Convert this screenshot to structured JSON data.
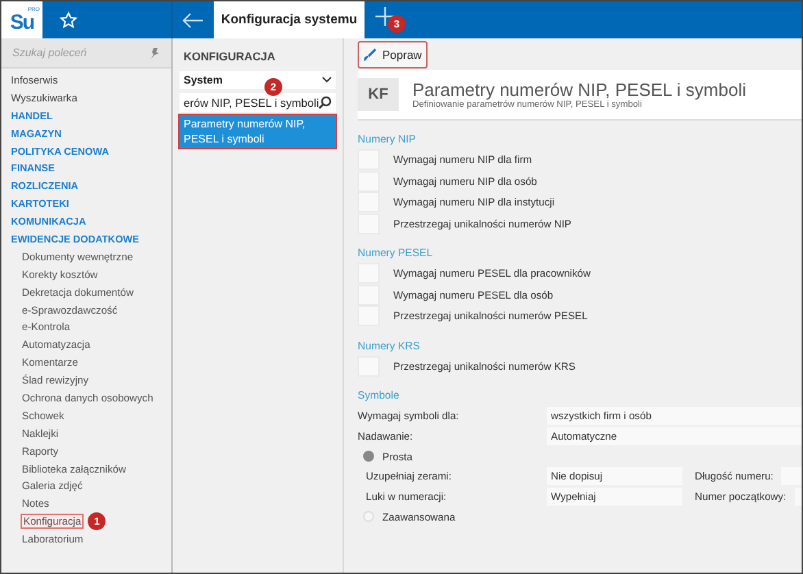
{
  "logo": {
    "text": "Su",
    "sup": "PRO"
  },
  "tab": {
    "title": "Konfiguracja systemu",
    "selected": true
  },
  "new_tab": {
    "badge": "3"
  },
  "sidebar": {
    "search_placeholder": "Szukaj poleceń",
    "items": [
      {
        "label": "Infoserwis",
        "kind": "plain"
      },
      {
        "label": "Wyszukiwarka",
        "kind": "plain"
      },
      {
        "label": "HANDEL",
        "kind": "section"
      },
      {
        "label": "MAGAZYN",
        "kind": "section"
      },
      {
        "label": "POLITYKA CENOWA",
        "kind": "section"
      },
      {
        "label": "FINANSE",
        "kind": "section"
      },
      {
        "label": "ROZLICZENIA",
        "kind": "section"
      },
      {
        "label": "KARTOTEKI",
        "kind": "section"
      },
      {
        "label": "KOMUNIKACJA",
        "kind": "section"
      },
      {
        "label": "EWIDENCJE DODATKOWE",
        "kind": "section"
      },
      {
        "label": "Dokumenty wewnętrzne",
        "kind": "item"
      },
      {
        "label": "Korekty kosztów",
        "kind": "item"
      },
      {
        "label": "Dekretacja dokumentów",
        "kind": "item"
      },
      {
        "label": "e-Sprawozdawczość",
        "kind": "item"
      },
      {
        "label": "e-Kontrola",
        "kind": "item"
      },
      {
        "label": "Automatyzacja",
        "kind": "item"
      },
      {
        "label": "Komentarze",
        "kind": "item"
      },
      {
        "label": "Ślad rewizyjny",
        "kind": "item"
      },
      {
        "label": "Ochrona danych osobowych",
        "kind": "item"
      },
      {
        "label": "Schowek",
        "kind": "item"
      },
      {
        "label": "Naklejki",
        "kind": "item"
      },
      {
        "label": "Raporty",
        "kind": "item"
      },
      {
        "label": "Biblioteka załączników",
        "kind": "item"
      },
      {
        "label": "Galeria zdjęć",
        "kind": "item"
      },
      {
        "label": "Notes",
        "kind": "item"
      },
      {
        "label": "Konfiguracja",
        "kind": "item",
        "highlighted": true,
        "badge": "1"
      },
      {
        "label": "Laboratorium",
        "kind": "item"
      }
    ]
  },
  "config_panel": {
    "title": "KONFIGURACJA",
    "select": "System",
    "search": {
      "value": "erów NIP, PESEL i symboli",
      "badge": "2"
    },
    "results": [
      {
        "label": "Parametry numerów NIP, PESEL i symboli",
        "selected": true,
        "highlighted": true
      }
    ]
  },
  "toolbar": {
    "buttons": [
      {
        "label": "Popraw",
        "highlighted": true
      }
    ]
  },
  "header": {
    "initials": "KF",
    "title": "Parametry numerów NIP, PESEL i symboli",
    "subtitle": "Definiowanie parametrów numerów NIP, PESEL i symboli"
  },
  "sections": [
    {
      "title": "Numery NIP",
      "checkboxes": [
        {
          "label": "Wymagaj numeru NIP dla firm",
          "checked": false
        },
        {
          "label": "Wymagaj numeru NIP dla osób",
          "checked": false
        },
        {
          "label": "Wymagaj numeru NIP dla instytucji",
          "checked": false
        },
        {
          "label": "Przestrzegaj unikalności numerów NIP",
          "checked": false
        }
      ]
    },
    {
      "title": "Numery PESEL",
      "checkboxes": [
        {
          "label": "Wymagaj numeru PESEL dla pracowników",
          "checked": false
        },
        {
          "label": "Wymagaj numeru PESEL dla osób",
          "checked": false
        },
        {
          "label": "Przestrzegaj unikalności numerów PESEL",
          "checked": false
        }
      ]
    },
    {
      "title": "Numery KRS",
      "checkboxes": [
        {
          "label": "Przestrzegaj unikalności numerów KRS",
          "checked": false
        }
      ]
    }
  ],
  "symbols": {
    "title": "Symbole",
    "fields": [
      {
        "label": "Wymagaj symboli dla:",
        "value": "wszystkich firm i osób"
      },
      {
        "label": "Nadawanie:",
        "value": "Automatyczne"
      }
    ],
    "modes": [
      {
        "label": "Prosta",
        "selected": true,
        "rows": [
          {
            "label": "Uzupełniaj zerami:",
            "value": "Nie dopisuj",
            "label_2": "Długość numeru:"
          },
          {
            "label": "Luki w numeracji:",
            "value": "Wypełniaj",
            "label_2": "Numer początkowy:"
          }
        ]
      },
      {
        "label": "Zaawansowana",
        "selected": false
      }
    ]
  }
}
